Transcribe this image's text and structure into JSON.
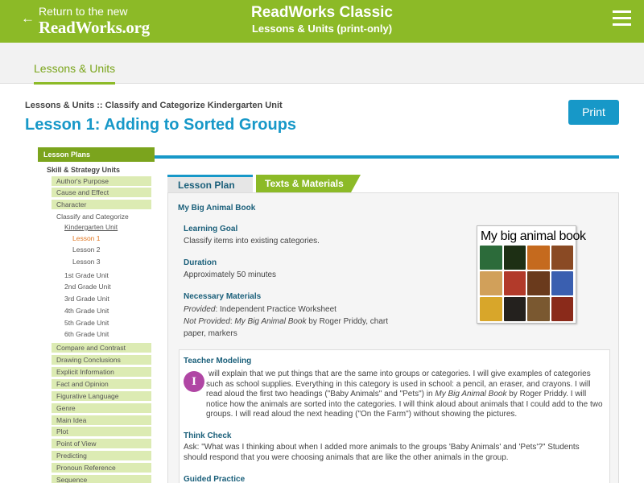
{
  "header": {
    "back_arrow": "←",
    "back_line1": "Return to the new",
    "back_line2": "ReadWorks.org",
    "title": "ReadWorks Classic",
    "subtitle": "Lessons & Units (print-only)",
    "menu_icon": "hamburger-icon"
  },
  "nav": {
    "tab_label": "Lessons & Units"
  },
  "breadcrumb": "Lessons & Units :: Classify and Categorize Kindergarten Unit",
  "page_title": "Lesson 1: Adding to Sorted Groups",
  "print_label": "Print",
  "sidebar": {
    "header": "Lesson Plans",
    "section": "Skill & Strategy Units",
    "skills_top": [
      "Author's Purpose",
      "Cause and Effect",
      "Character"
    ],
    "classify_label": "Classify and Categorize",
    "kindergarten_label": "Kindergarten Unit",
    "lessons": [
      "Lesson 1",
      "Lesson 2",
      "Lesson 3"
    ],
    "grade_units": [
      "1st Grade Unit",
      "2nd Grade Unit",
      "3rd Grade Unit",
      "4th Grade Unit",
      "5th Grade Unit",
      "6th Grade Unit"
    ],
    "skills_bottom": [
      "Compare and Contrast",
      "Drawing Conclusions",
      "Explicit Information",
      "Fact and Opinion",
      "Figurative Language",
      "Genre",
      "Main Idea",
      "Plot",
      "Point of View",
      "Predicting",
      "Pronoun Reference",
      "Sequence"
    ]
  },
  "tabs": {
    "lesson_plan": "Lesson Plan",
    "texts_materials": "Texts & Materials"
  },
  "content": {
    "book_title": "My Big Animal Book",
    "learning_goal_head": "Learning Goal",
    "learning_goal_text": "Classify items into existing categories.",
    "duration_head": "Duration",
    "duration_text": "Approximately 50 minutes",
    "materials_head": "Necessary Materials",
    "materials_provided_label": "Provided",
    "materials_provided_text": ": Independent Practice Worksheet",
    "materials_notprovided_label": "Not Provided",
    "materials_sep": ": ",
    "materials_book": "My Big Animal Book",
    "materials_notprovided_rest1": " by Roger Priddy, chart",
    "materials_notprovided_rest2": "paper, markers",
    "cover_title": "My big animal book",
    "teacher_modeling_head": "Teacher Modeling",
    "i_badge": "I",
    "tm_line1": "will explain that we put things that are the same into groups or categories. I will give examples of categories",
    "tm_line2": "such as school supplies. Everything in this category is used in school: a pencil, an eraser, and crayons. I will",
    "tm_line3_a": "read aloud the first two headings (\"Baby Animals\" and \"Pets\") in ",
    "tm_line3_book": "My Big Animal Book",
    "tm_line3_b": " by Roger Priddy. I will",
    "tm_line4": "notice how the animals are sorted into the categories. I will think aloud about animals that I could add to the two",
    "tm_line5": "groups. I will read aloud the next heading (\"On the Farm\") without showing the pictures.",
    "think_check_head": "Think Check",
    "tc_line1": "Ask: \"What was I thinking about when I added more animals to the groups 'Baby Animals' and 'Pets'?\" Students",
    "tc_line2": "should respond that you were choosing animals that are like the other animals in the group.",
    "guided_practice_head": "Guided Practice"
  },
  "colors": {
    "brand_green": "#8cba27",
    "brand_blue": "#1798c8",
    "sidebar_item_bg": "#dcebb3",
    "badge_purple": "#b046a4"
  }
}
